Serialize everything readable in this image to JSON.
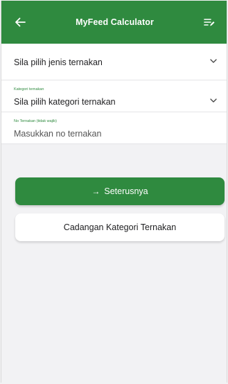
{
  "appbar": {
    "title": "MyFeed Calculator",
    "back_icon": "arrow-left-icon",
    "menu_icon": "list-edit-icon"
  },
  "fields": {
    "livestock_type": {
      "value": "Sila pilih jenis ternakan"
    },
    "livestock_category": {
      "label": "Kategori ternakan",
      "value": "Sila pilih kategori ternakan"
    },
    "livestock_number": {
      "label": "No Ternakan (tidak wajib)",
      "placeholder": "Masukkan no ternakan"
    }
  },
  "buttons": {
    "next_arrow": "→",
    "next_label": "Seterusnya",
    "suggest_label": "Cadangan Kategori Ternakan"
  },
  "colors": {
    "primary": "#2f8a3f",
    "background": "#f2f2f4"
  }
}
